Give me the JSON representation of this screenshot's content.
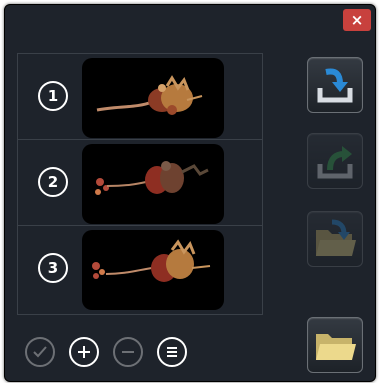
{
  "dialog": {
    "close_label": "×"
  },
  "items": [
    {
      "number": "1",
      "thumbnail": "embryo-model-1"
    },
    {
      "number": "2",
      "thumbnail": "embryo-model-2"
    },
    {
      "number": "3",
      "thumbnail": "embryo-model-3"
    }
  ],
  "side_buttons": [
    {
      "icon": "import-icon",
      "state": "enabled"
    },
    {
      "icon": "export-icon",
      "state": "disabled"
    },
    {
      "icon": "open-folder-import-icon",
      "state": "disabled"
    },
    {
      "icon": "folder-icon",
      "state": "enabled"
    }
  ],
  "bottom_buttons": [
    {
      "icon": "check-icon",
      "state": "disabled"
    },
    {
      "icon": "plus-icon",
      "state": "enabled"
    },
    {
      "icon": "minus-icon",
      "state": "disabled"
    },
    {
      "icon": "menu-icon",
      "state": "enabled"
    }
  ],
  "colors": {
    "background": "#1e232b",
    "close": "#c8413d",
    "accent_blue": "#2a8ad6",
    "accent_green": "#3aa853"
  }
}
